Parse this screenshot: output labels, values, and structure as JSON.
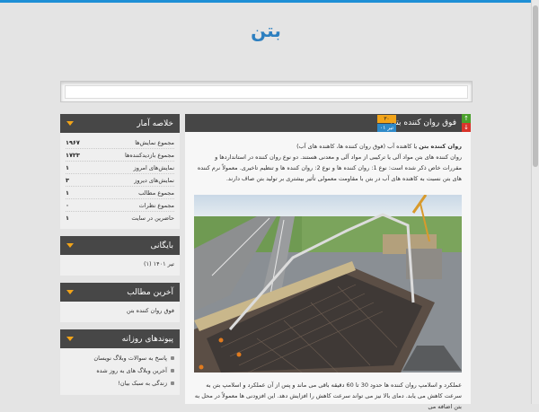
{
  "site": {
    "title": "بتن"
  },
  "sidebar": {
    "stats": {
      "title": "خلاصه آمار",
      "rows": [
        {
          "label": "مجموع نمایش‌ها",
          "value": "۱۹۶۷"
        },
        {
          "label": "مجموع بازدیدکننده‌ها",
          "value": "۱۷۲۳"
        },
        {
          "label": "نمایش‌های امروز",
          "value": "۱"
        },
        {
          "label": "نمایش‌های دیروز",
          "value": "۳"
        },
        {
          "label": "مجموع مطالب",
          "value": "۱"
        },
        {
          "label": "مجموع نظرات",
          "value": "۰"
        },
        {
          "label": "حاضرین در سایت",
          "value": "۱"
        }
      ]
    },
    "archive": {
      "title": "بایگانی",
      "items": [
        "تیر ۱۴۰۱ (۱)"
      ]
    },
    "latest": {
      "title": "آخرین مطالب",
      "items": [
        "فوق روان کننده بتن"
      ]
    },
    "daily": {
      "title": "پیوندهای روزانه",
      "items": [
        "پاسخ به سوالات وبلاگ نویسان",
        "آخرین وبلاگ های به روز شده",
        "زندگی به سبک بیان!"
      ]
    }
  },
  "post": {
    "title": "فوق روان کننده بتن",
    "score": "۳۰",
    "date": "تیر ۰۱",
    "lead_bold": "روان کننده بتن",
    "lead_rest": " یا کاهنده آب (فوق روان کننده ها، کاهنده های آب)",
    "paragraph": "روان کننده های بتن مواد آلی یا ترکیبی از مواد آلی و معدنی هستند. دو نوع روان کننده در استانداردها و مقررات خاص ذکر شده است: نوع 1: روان کننده ها و نوع 2: روان کننده ها و تنظیم تاخیری. معمولاً نرم کننده های بتن نسبت به کاهنده های آب در بتن با مقاومت معمولی تأثیر بیشتری بر تولید بتن صاف دارند.",
    "footer": "عملکرد و اسلامپ روان کننده ها حدود 30 تا 60 دقیقه باقی می ماند و پس از آن عملکرد و اسلامپ بتن به سرعت کاهش می یابد. دمای بالا نیز می تواند سرعت کاهش را افزایش دهد. این افزودنی ها معمولاً در محل به بتن اضافه می"
  },
  "colors": {
    "accent": "#2c7fc0",
    "header_bg": "#464646",
    "score_bg": "#f2a419",
    "date_bg": "#2f8ac8"
  }
}
